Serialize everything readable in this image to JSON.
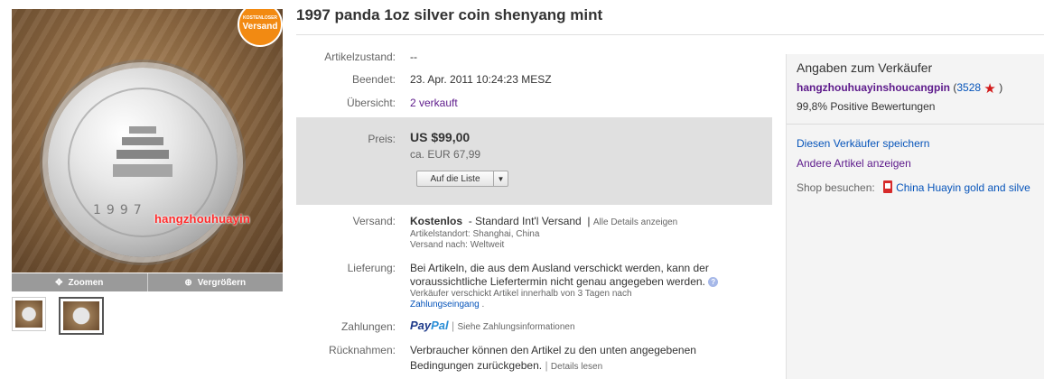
{
  "gallery": {
    "badge_line1": "KOSTENLOSER",
    "badge_line2": "Versand",
    "watermark": "hangzhouhuayin",
    "coin_year": "1997",
    "zoom_label": "Zoomen",
    "enlarge_label": "Vergrößern",
    "selected_thumbnail": 2
  },
  "item": {
    "title": "1997 panda 1oz silver coin shenyang mint",
    "condition_label": "Artikelzustand:",
    "condition_value": "--",
    "ended_label": "Beendet:",
    "ended_value": "23. Apr. 2011 10:24:23 MESZ",
    "overview_label": "Übersicht:",
    "overview_value": "2 verkauft"
  },
  "price": {
    "label": "Preis:",
    "value": "US $99,00",
    "converted": "ca. EUR 67,99",
    "watchlist_button": "Auf die Liste"
  },
  "shipping": {
    "label": "Versand:",
    "cost": "Kostenlos",
    "service": "- Standard Int'l Versand",
    "details_link": "Alle Details anzeigen",
    "location": "Artikelstandort: Shanghai, China",
    "ships_to": "Versand nach: Weltweit"
  },
  "delivery": {
    "label": "Lieferung:",
    "line1": "Bei Artikeln, die aus dem Ausland verschickt werden, kann der",
    "line2": "voraussichtliche Liefertermin nicht genau angegeben werden.",
    "handling": "Verkäufer verschickt Artikel innerhalb von 3 Tagen nach",
    "handling_link": "Zahlungseingang",
    "handling_suffix": "."
  },
  "payments": {
    "label": "Zahlungen:",
    "paypal_a": "Pay",
    "paypal_b": "Pal",
    "link": "Siehe Zahlungsinformationen"
  },
  "returns": {
    "label": "Rücknahmen:",
    "line1": "Verbraucher können den Artikel zu den unten angegebenen",
    "line2": "Bedingungen zurückgeben.",
    "link": "Details lesen"
  },
  "seller": {
    "title": "Angaben zum Verkäufer",
    "username": "hangzhouhuayinshoucangpin",
    "feedback_open": "(",
    "feedback_score": "3528",
    "feedback_close": ")",
    "positive": "99,8% Positive Bewertungen",
    "save_link": "Diesen Verkäufer speichern",
    "other_items_link": "Andere Artikel anzeigen",
    "shop_label": "Shop besuchen:",
    "shop_name": "China Huayin gold and silve"
  }
}
